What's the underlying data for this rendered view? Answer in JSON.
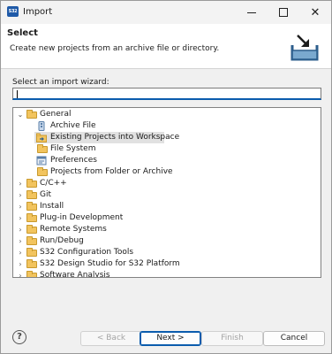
{
  "window": {
    "app_icon_text": "S32",
    "title": "Import"
  },
  "banner": {
    "title": "Select",
    "description": "Create new projects from an archive file or directory."
  },
  "filter": {
    "label": "Select an import wizard:",
    "value": ""
  },
  "tree": {
    "root": {
      "label": "General",
      "expanded": true
    },
    "children": [
      {
        "label": "Archive File",
        "icon": "archive-file-icon"
      },
      {
        "label": "Existing Projects into Workspace",
        "icon": "existing-projects-icon",
        "selected": true
      },
      {
        "label": "File System",
        "icon": "folder-icon"
      },
      {
        "label": "Preferences",
        "icon": "preferences-icon"
      },
      {
        "label": "Projects from Folder or Archive",
        "icon": "folder-icon"
      }
    ],
    "categories": [
      "C/C++",
      "Git",
      "Install",
      "Plug-in Development",
      "Remote Systems",
      "Run/Debug",
      "S32 Configuration Tools",
      "S32 Design Studio for S32 Platform",
      "Software Analysis"
    ]
  },
  "buttons": {
    "help": "?",
    "back": "< Back",
    "next": "Next >",
    "finish": "Finish",
    "cancel": "Cancel"
  },
  "colors": {
    "accent": "#0b5cad",
    "selection": "#e1e1e1",
    "folder": "#f2c45e"
  }
}
